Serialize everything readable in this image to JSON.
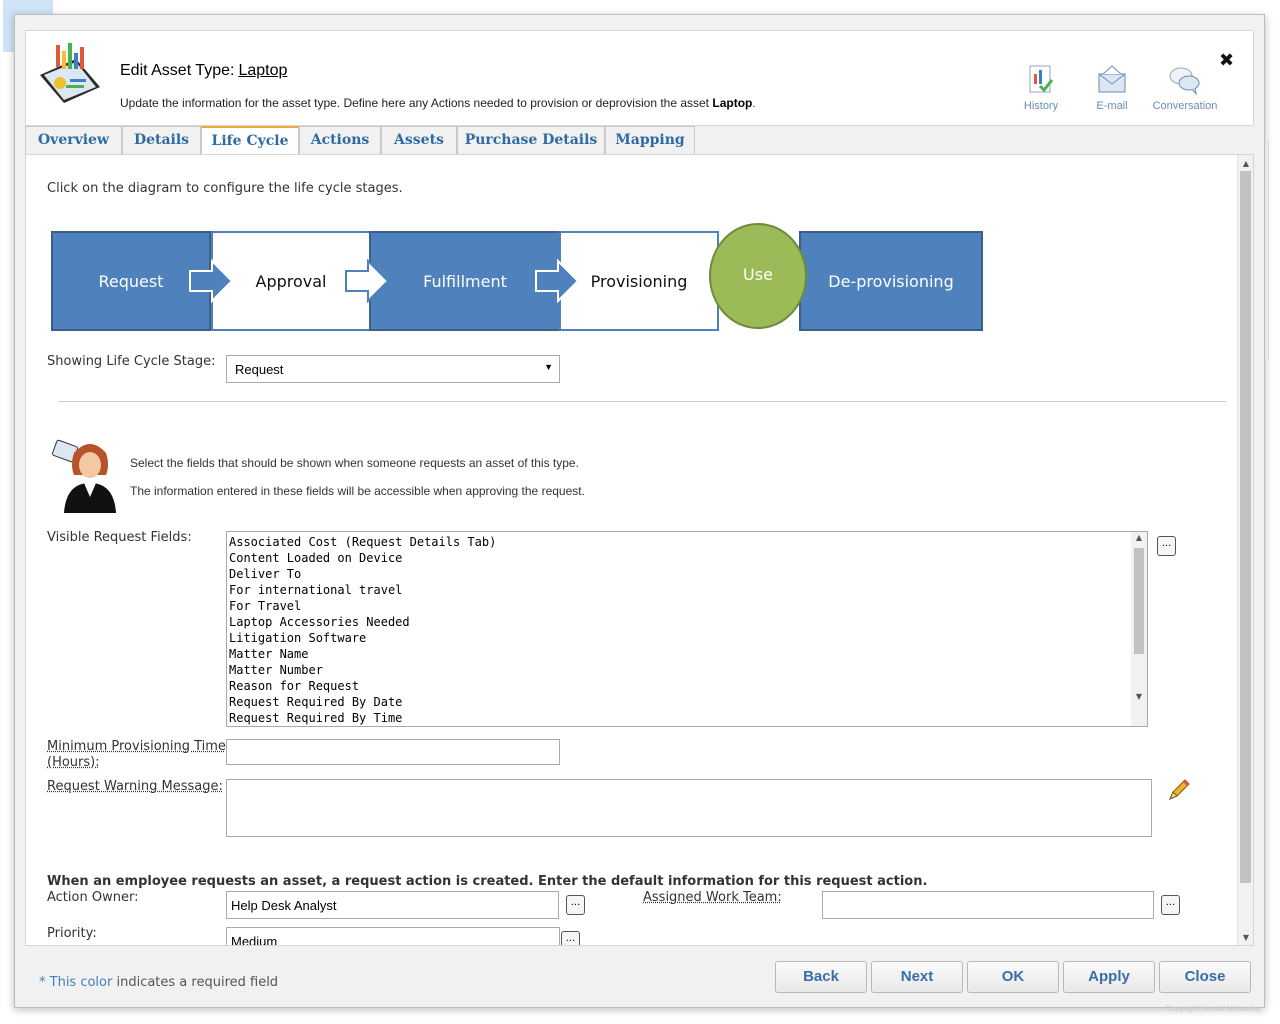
{
  "header": {
    "title_prefix": "Edit Asset Type:",
    "title_asset": "Laptop",
    "desc_text": "Update the information for the asset type. Define here any Actions needed to provision or deprovision the asset",
    "desc_asset": "Laptop",
    "desc_suffix": ".",
    "buttons": [
      {
        "label": "History",
        "icon": "history-icon"
      },
      {
        "label": "E-mail",
        "icon": "email-icon"
      },
      {
        "label": "Conversation",
        "icon": "conversation-icon"
      }
    ],
    "close": "✖"
  },
  "tabs": [
    {
      "label": "Overview"
    },
    {
      "label": "Details"
    },
    {
      "label": "Life Cycle"
    },
    {
      "label": "Actions"
    },
    {
      "label": "Assets"
    },
    {
      "label": "Purchase Details"
    },
    {
      "label": "Mapping"
    }
  ],
  "active_tab": "Life Cycle",
  "lifecycle": {
    "instruction": "Click on the diagram to configure the life cycle stages.",
    "stages": [
      "Request",
      "Approval",
      "Fulfillment",
      "Provisioning",
      "Use",
      "De-provisioning"
    ],
    "colors": {
      "blue": "#4f81bd",
      "green": "#9bbb59",
      "accent": "#f0a83a"
    }
  },
  "stage_select": {
    "label": "Showing Life Cycle Stage:",
    "value": "Request"
  },
  "info": {
    "line1": "Select the fields that should be shown when someone requests an asset of this type.",
    "line2": "The information entered in these fields will be accessible when approving the request."
  },
  "visible_fields": {
    "label": "Visible Request Fields:",
    "items": [
      "Associated Cost (Request Details Tab)",
      "Content Loaded on Device",
      "Deliver To",
      "For international travel",
      "For Travel",
      "Laptop Accessories Needed",
      "Litigation Software",
      "Matter Name",
      "Matter Number",
      "Reason for Request",
      "Request Required By Date",
      "Request Required By Time"
    ],
    "button": "..."
  },
  "min_provisioning": {
    "label_line1": "Minimum Provisioning Time",
    "label_line2": "(Hours):",
    "value": ""
  },
  "warning_message": {
    "label": "Request Warning Message:",
    "value": ""
  },
  "request_note": "When an employee requests an asset, a request action is created. Enter the default information for this request action.",
  "action_owner": {
    "label": "Action Owner:",
    "value": "Help Desk Analyst",
    "button": "..."
  },
  "work_team": {
    "label": "Assigned Work Team:",
    "value": "",
    "button": "..."
  },
  "priority": {
    "label": "Priority:",
    "value": "Medium",
    "button": "..."
  },
  "footer": {
    "required_star": "* This color",
    "required_text": " indicates a required field",
    "buttons": [
      "Back",
      "Next",
      "OK",
      "Apply",
      "Close"
    ],
    "copyright": "Copyright Vector Networks"
  }
}
